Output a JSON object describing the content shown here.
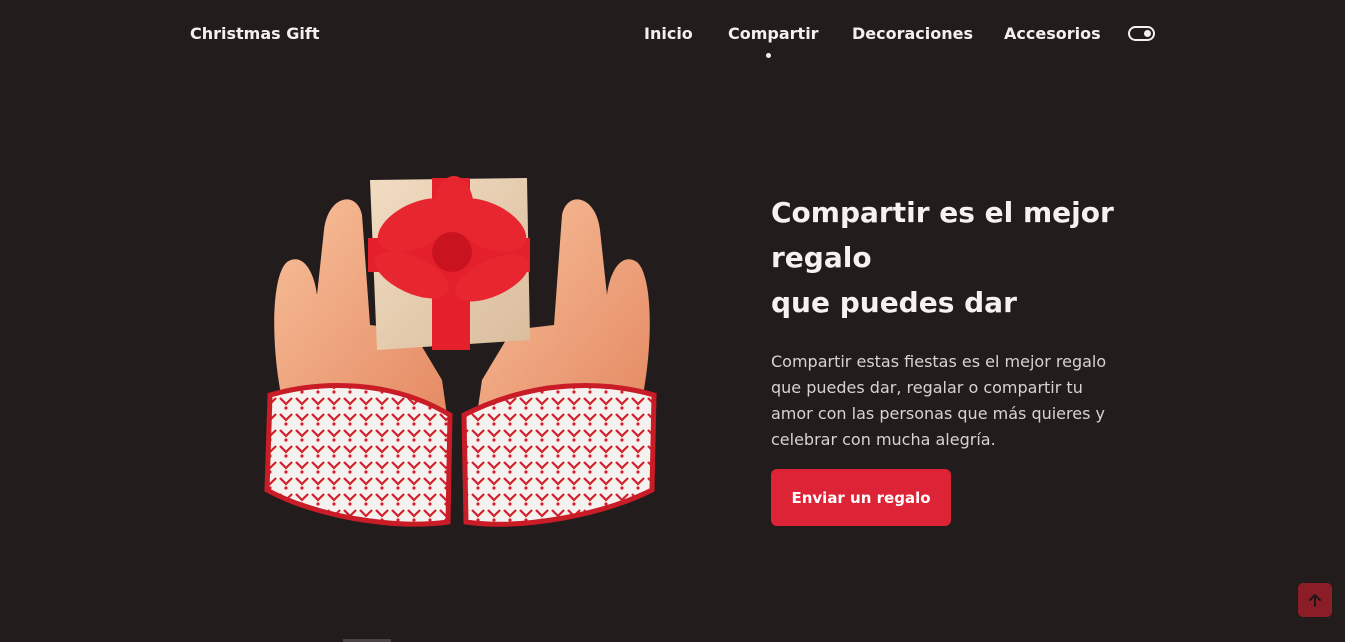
{
  "header": {
    "logo": "Christmas Gift",
    "nav": [
      {
        "label": "Inicio",
        "active": false
      },
      {
        "label": "Compartir",
        "active": true
      },
      {
        "label": "Decoraciones",
        "active": false
      },
      {
        "label": "Accesorios",
        "active": false
      }
    ],
    "theme_toggle_icon": "toggle-icon"
  },
  "hero": {
    "title_lines": [
      "Compartir es el mejor",
      "regalo",
      "que puedes dar"
    ],
    "description": "Compartir estas fiestas es el mejor regalo que puedes dar, regalar o compartir tu amor con las personas que más quieres y celebrar con mucha alegría.",
    "button_label": "Enviar un regalo",
    "image_icon": "hands-gift-illustration"
  },
  "scroll_up_icon": "arrow-up-icon",
  "colors": {
    "background": "#231c1d",
    "accent": "#dc2436",
    "scroll_button": "#8b1d27",
    "text": "#f5f1f1"
  }
}
